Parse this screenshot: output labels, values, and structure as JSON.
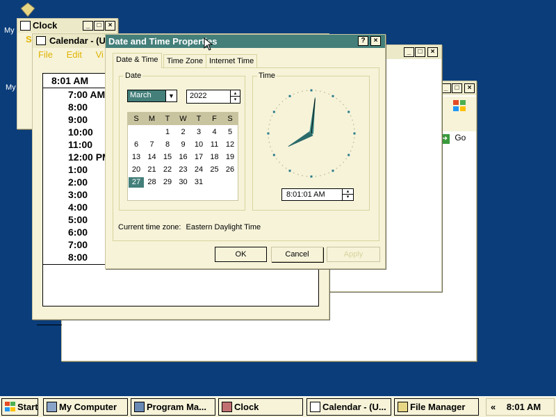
{
  "desktop": {
    "icon_label_1": "My",
    "icon_label_2": "My"
  },
  "clock_window": {
    "title": "Clock",
    "menu_fragment": "S"
  },
  "calendar_window": {
    "title": "Calendar - (U",
    "menu": [
      "File",
      "Edit",
      "Vi"
    ],
    "current_time": "8:01 AM",
    "times": [
      "7:00 AM",
      "8:00",
      "9:00",
      "10:00",
      "11:00",
      "12:00 PM",
      "1:00",
      "2:00",
      "3:00",
      "4:00",
      "5:00",
      "6:00",
      "7:00",
      "8:00"
    ]
  },
  "browser_window": {
    "go_label": "Go"
  },
  "dialog": {
    "title": "Date and Time Properties",
    "help_button": "?",
    "close_button": "×",
    "tabs": [
      "Date & Time",
      "Time Zone",
      "Internet Time"
    ],
    "date_group": "Date",
    "month": "March",
    "year": "2022",
    "weekdays": [
      "S",
      "M",
      "T",
      "W",
      "T",
      "F",
      "S"
    ],
    "days": [
      "1",
      "2",
      "3",
      "4",
      "5",
      "6",
      "7",
      "8",
      "9",
      "10",
      "11",
      "12",
      "13",
      "14",
      "15",
      "16",
      "17",
      "18",
      "19",
      "20",
      "21",
      "22",
      "23",
      "24",
      "25",
      "26",
      "27",
      "28",
      "29",
      "30",
      "31"
    ],
    "first_weekday_index": 2,
    "selected_day": "27",
    "time_group": "Time",
    "clock_time": {
      "hour": 8,
      "minute": 1,
      "second": 1
    },
    "time_value": "8:01:01 AM",
    "timezone_label": "Current time zone:",
    "timezone_value": "Eastern Daylight Time",
    "ok": "OK",
    "cancel": "Cancel",
    "apply": "Apply"
  },
  "taskbar": {
    "start": "Start",
    "buttons": [
      "My Computer",
      "Program Ma...",
      "Clock",
      "Calendar - (U...",
      "File Manager"
    ],
    "tray_arrow": "«",
    "tray_time": "8:01 AM"
  },
  "colors": {
    "desktop": "#0a3d7a",
    "active_title": "#447f7a",
    "window": "#f6f3d9",
    "menu_text": "#e0b400",
    "tick": "#2a7a8a"
  }
}
